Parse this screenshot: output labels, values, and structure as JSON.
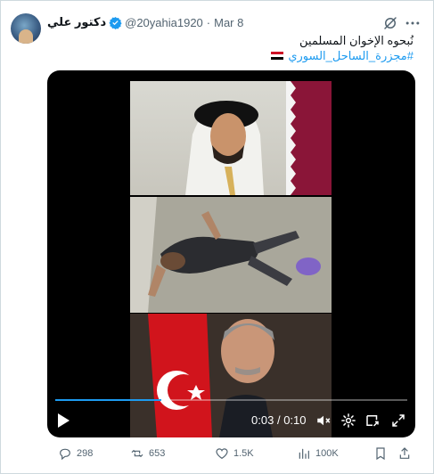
{
  "tweet": {
    "author_name": "دكتور علي",
    "handle": "@20yahia1920",
    "separator": "·",
    "date": "Mar 8",
    "text_line1": "نُبحوه الإخوان المسلمين",
    "hashtag": "#مجزرة_الساحل_السوري"
  },
  "video": {
    "time_current": "0:03",
    "time_separator": "/",
    "time_total": "0:10",
    "progress": 0.3
  },
  "actions": {
    "replies": "298",
    "reposts": "653",
    "likes": "1.5K",
    "views": "100K"
  },
  "colors": {
    "accent": "#1d9bf0",
    "muted": "#536471",
    "text": "#0f1419"
  }
}
